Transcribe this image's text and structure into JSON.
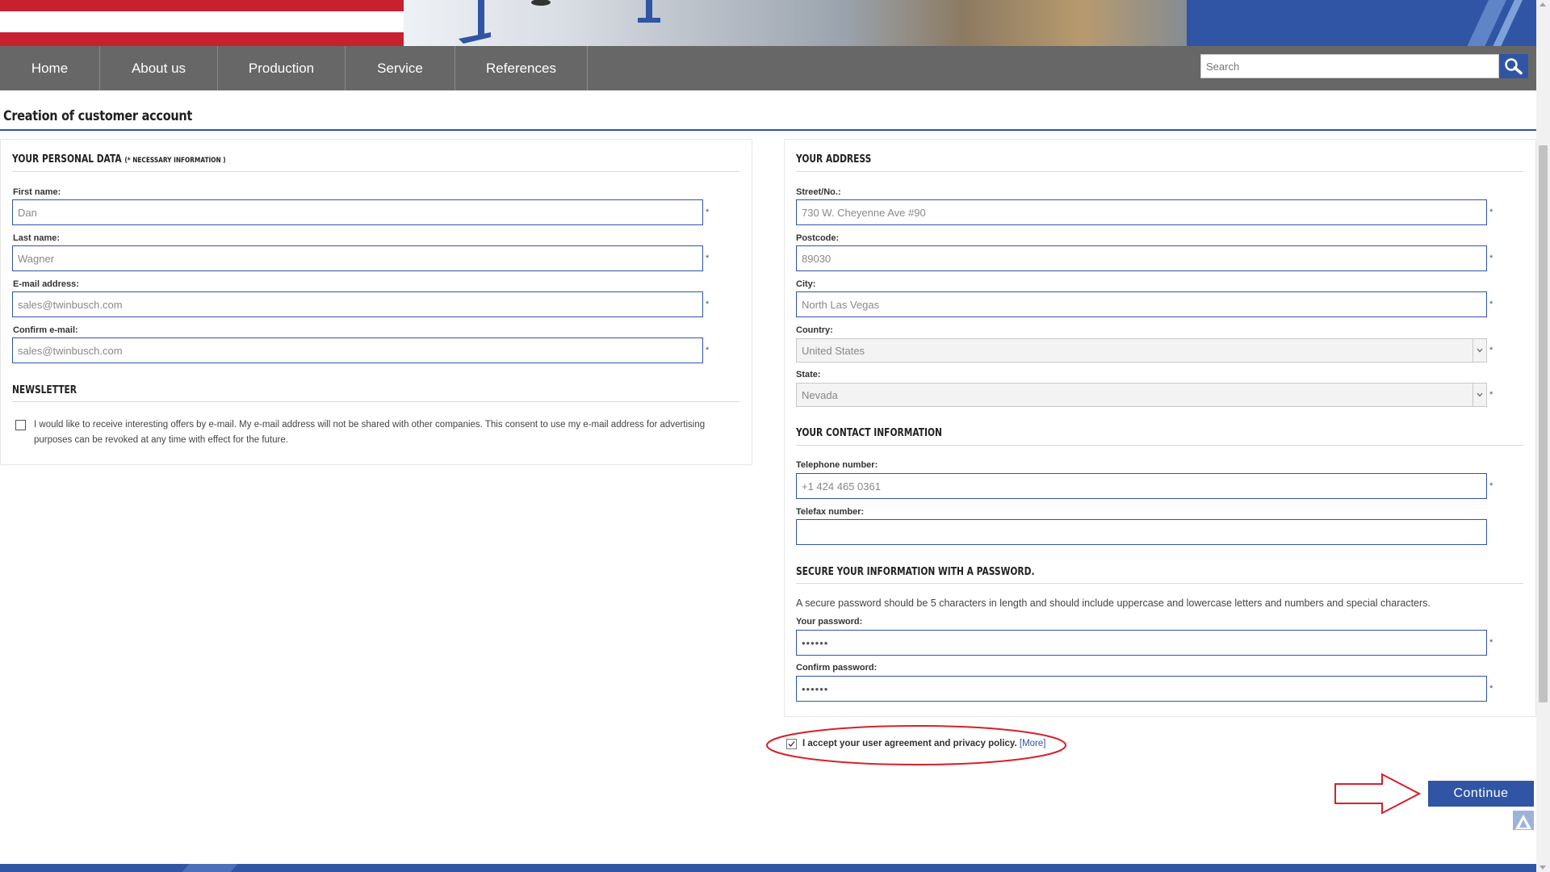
{
  "nav": {
    "items": [
      "Home",
      "About us",
      "Production",
      "Service",
      "References"
    ],
    "search_placeholder": "Search"
  },
  "page": {
    "title": "Creation of customer account"
  },
  "personal": {
    "heading": "YOUR PERSONAL DATA",
    "heading_note": "(* NECESSARY INFORMATION )",
    "first_name_label": "First name:",
    "first_name_value": "Dan",
    "last_name_label": "Last name:",
    "last_name_value": "Wagner",
    "email_label": "E-mail address:",
    "email_value": "sales@twinbusch.com",
    "confirm_email_label": "Confirm e-mail:",
    "confirm_email_value": "sales@twinbusch.com",
    "required_mark": "*"
  },
  "newsletter": {
    "heading": "NEWSLETTER",
    "text": "I would like to receive interesting offers by e-mail. My e-mail address will not be shared with other companies. This consent to use my e-mail address for advertising purposes can be revoked at any time with effect for the future.",
    "checked": false
  },
  "address": {
    "heading": "YOUR ADDRESS",
    "street_label": "Street/No.:",
    "street_value": "730 W. Cheyenne Ave #90",
    "postcode_label": "Postcode:",
    "postcode_value": "89030",
    "city_label": "City:",
    "city_value": "North Las Vegas",
    "country_label": "Country:",
    "country_value": "United States",
    "state_label": "State:",
    "state_value": "Nevada"
  },
  "contact": {
    "heading": "YOUR CONTACT INFORMATION",
    "phone_label": "Telephone number:",
    "phone_value": "+1 424 465 0361",
    "fax_label": "Telefax number:",
    "fax_value": ""
  },
  "password": {
    "heading": "SECURE YOUR INFORMATION WITH A PASSWORD.",
    "hint": "A secure password should be 5 characters in length and should include uppercase and lowercase letters and numbers and special characters.",
    "password_label": "Your password:",
    "password_value": "••••••",
    "confirm_label": "Confirm password:",
    "confirm_value": "••••••"
  },
  "agreement": {
    "text": "I accept your user agreement and privacy policy.",
    "more_link": "[More]",
    "checked": true
  },
  "actions": {
    "continue_label": "Continue"
  },
  "colors": {
    "brand_blue": "#2f55a4",
    "nav_gray": "#676767",
    "annotation_red": "#d6212b"
  }
}
